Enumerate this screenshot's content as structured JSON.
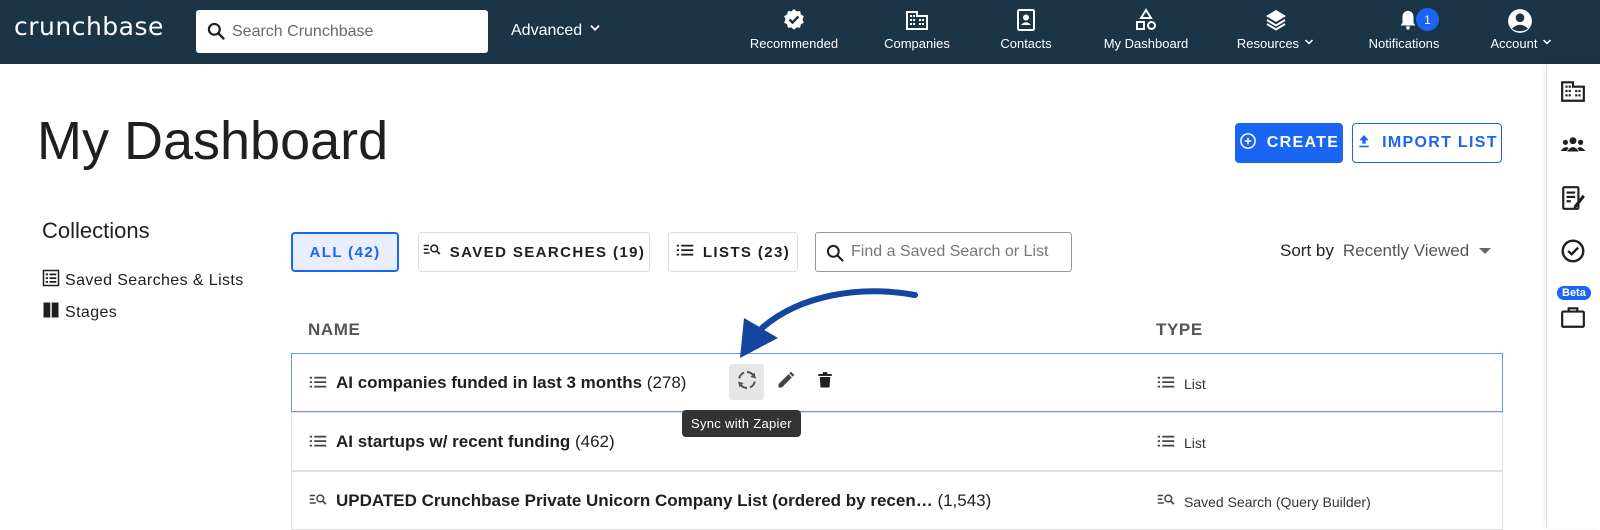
{
  "header": {
    "logo": "crunchbase",
    "search_placeholder": "Search Crunchbase",
    "advanced_label": "Advanced",
    "nav": {
      "recommended": "Recommended",
      "companies": "Companies",
      "contacts": "Contacts",
      "my_dashboard": "My Dashboard",
      "resources": "Resources",
      "notifications": "Notifications",
      "notifications_count": "1",
      "account": "Account"
    }
  },
  "page": {
    "title": "My Dashboard",
    "create_label": "CREATE",
    "import_label": "IMPORT LIST"
  },
  "sidebar": {
    "title": "Collections",
    "items": [
      "Saved Searches & Lists",
      "Stages"
    ]
  },
  "filters": {
    "all": "ALL (42)",
    "saved_searches": "SAVED SEARCHES (19)",
    "lists": "LISTS (23)",
    "find_placeholder": "Find a Saved Search or List",
    "sort_label": "Sort by",
    "sort_value": "Recently Viewed"
  },
  "table": {
    "col_name": "NAME",
    "col_type": "TYPE",
    "rows": [
      {
        "name": "AI companies funded in last 3 months",
        "count": "(278)",
        "type": "List"
      },
      {
        "name": "AI startups w/ recent funding",
        "count": "(462)",
        "type": "List"
      },
      {
        "name": "UPDATED Crunchbase Private Unicorn Company List (ordered by recen…",
        "count": "(1,543)",
        "type": "Saved Search (Query Builder)"
      }
    ]
  },
  "tooltip": "Sync with Zapier",
  "rightrail": {
    "beta": "Beta"
  },
  "colors": {
    "header_bg": "#1b3446",
    "accent": "#1a65f3",
    "arrow": "#1446a0"
  }
}
